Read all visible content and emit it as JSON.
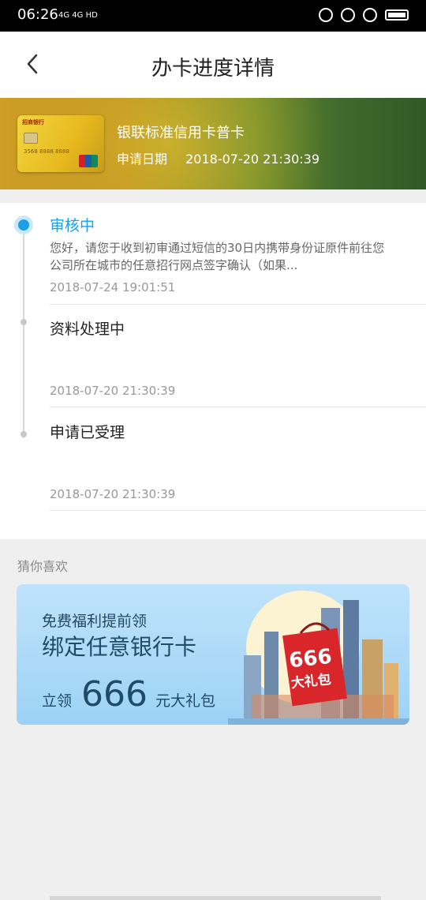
{
  "status_bar": {
    "time": "06:26",
    "network": "4G 4G HD"
  },
  "nav": {
    "title": "办卡进度详情"
  },
  "card": {
    "name": "银联标准信用卡普卡",
    "date_label": "申请日期",
    "date_value": "2018-07-20 21:30:39",
    "bank_text": "招商银行",
    "card_number_text": "3568 8888 8888"
  },
  "timeline": [
    {
      "title": "审核中",
      "description": "您好，请您于收到初审通过短信的30日内携带身份证原件前往您公司所在城市的任意招行网点签字确认（如果...",
      "time": "2018-07-24 19:01:51"
    },
    {
      "title": "资料处理中",
      "time": "2018-07-20 21:30:39"
    },
    {
      "title": "申请已受理",
      "time": "2018-07-20 21:30:39"
    }
  ],
  "recommend": {
    "section_title": "猜你喜欢",
    "promo": {
      "subtitle": "免费福利提前领",
      "title": "绑定任意银行卡",
      "prefix": "立领",
      "number": "666",
      "suffix": "元大礼包",
      "bag_number": "666",
      "bag_text": "大礼包"
    }
  },
  "colors": {
    "accent": "#1aa0e8",
    "promo_bg": "#bfe3fb",
    "bag_red": "#d8262b"
  }
}
